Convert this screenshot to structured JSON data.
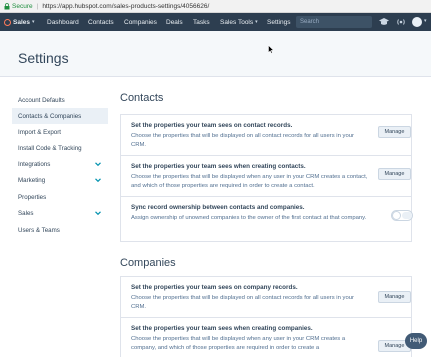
{
  "browser": {
    "secure_label": "Secure",
    "url": "https://app.hubspot.com/sales-products-settings/4056626/"
  },
  "nav": {
    "brand": "Sales",
    "items": [
      "Dashboard",
      "Contacts",
      "Companies",
      "Deals",
      "Tasks",
      "Sales Tools",
      "Settings"
    ],
    "search_placeholder": "Search"
  },
  "header": {
    "title": "Settings"
  },
  "sidebar": {
    "items": [
      {
        "label": "Account Defaults"
      },
      {
        "label": "Contacts & Companies"
      },
      {
        "label": "Import & Export"
      },
      {
        "label": "Install Code & Tracking"
      },
      {
        "label": "Integrations"
      },
      {
        "label": "Marketing"
      },
      {
        "label": "Properties"
      },
      {
        "label": "Sales"
      },
      {
        "label": "Users & Teams"
      }
    ]
  },
  "contacts": {
    "title": "Contacts",
    "rows": [
      {
        "title": "Set the properties your team sees on contact records.",
        "desc": "Choose the properties that will be displayed on all contact records for all users in your CRM.",
        "action": "Manage"
      },
      {
        "title": "Set the properties your team sees when creating contacts.",
        "desc": "Choose the properties that will be displayed when any user in your CRM creates a contact, and which of those properties are required in order to create a contact.",
        "action": "Manage"
      },
      {
        "title": "Sync record ownership between contacts and companies.",
        "desc": "Assign ownership of unowned companies to the owner of the first contact at that company."
      }
    ]
  },
  "companies": {
    "title": "Companies",
    "rows": [
      {
        "title": "Set the properties your team sees on company records.",
        "desc": "Choose the properties that will be displayed on all contact records for all users in your CRM.",
        "action": "Manage"
      },
      {
        "title": "Set the properties your team sees when creating companies.",
        "desc": "Choose the properties that will be displayed when any user in your CRM creates a company, and which of those properties are required in order to create a",
        "action": "Manage"
      }
    ]
  },
  "help_label": "Help"
}
